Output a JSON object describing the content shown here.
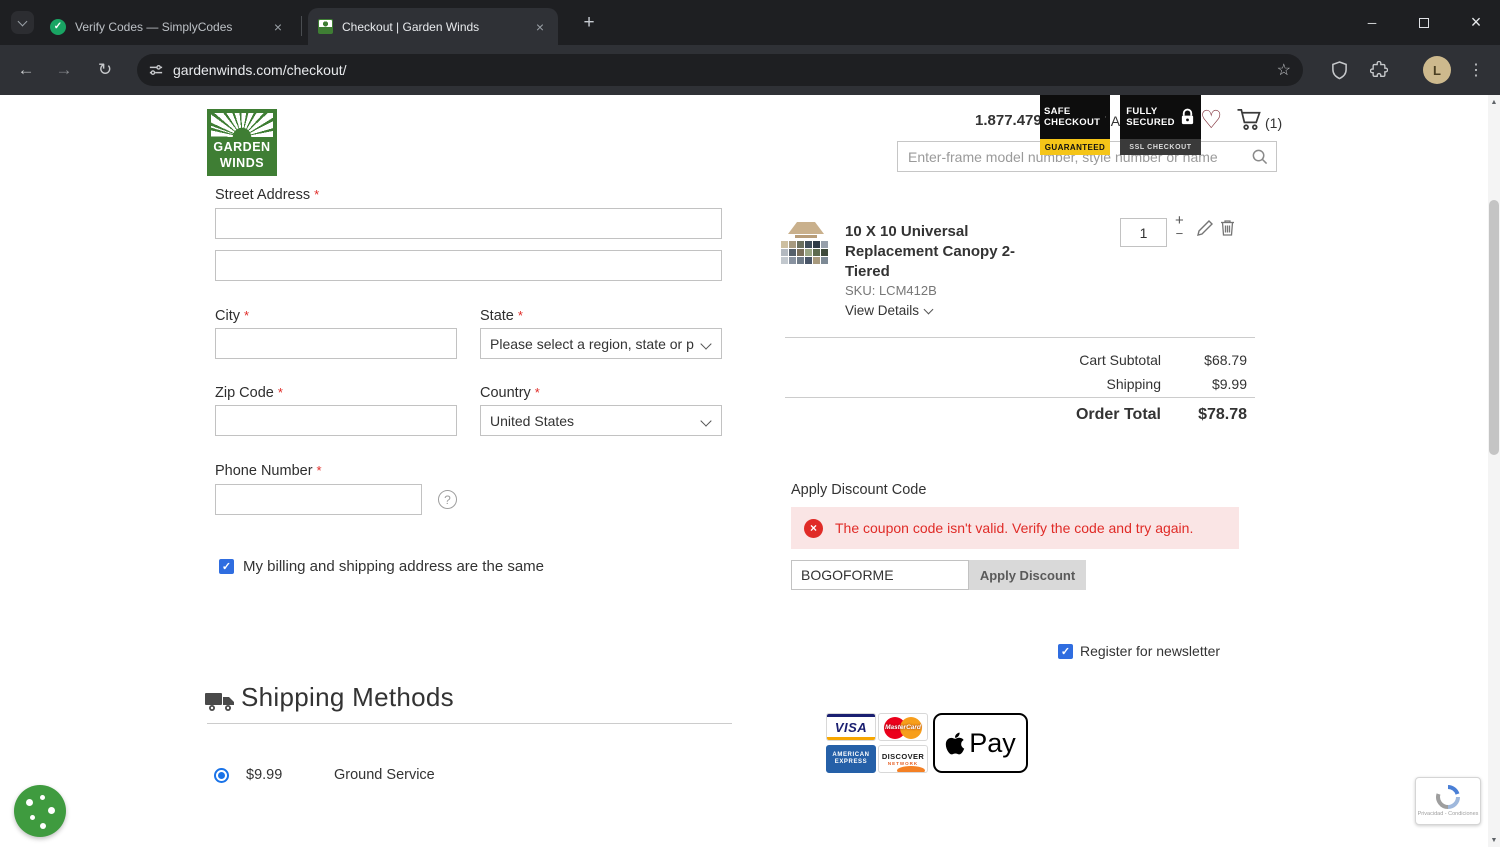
{
  "icons": {
    "close": "×",
    "new_tab": "+",
    "minimize": "─",
    "maximize": "",
    "back": "←",
    "forward": "→",
    "reload": "↻",
    "star": "☆",
    "kebab": "⋮",
    "heart": "♡",
    "caret_down": "▾",
    "help": "?",
    "check": "✓",
    "error_x": "×",
    "plus": "+",
    "minus": "−",
    "up": "▲",
    "down": "▼",
    "fav_check": "✓"
  },
  "browser": {
    "tabs": [
      {
        "title": "Verify Codes — SimplyCodes"
      },
      {
        "title": "Checkout | Garden Winds"
      }
    ],
    "url": "gardenwinds.com/checkout/",
    "avatar": "L"
  },
  "header": {
    "logo_top": "GARDEN",
    "logo_bottom": "WINDS",
    "phone": "1.877.479.4637",
    "account": "My Account",
    "cart_count": "(1)",
    "search_placeholder": "Enter-frame model number, style number or name"
  },
  "form": {
    "required_mark": "*",
    "street_label": "Street Address",
    "city_label": "City",
    "state_label": "State",
    "state_value": "Please select a region, state or p",
    "zip_label": "Zip Code",
    "country_label": "Country",
    "country_value": "United States",
    "phone_label": "Phone Number",
    "billing_checkbox": "My billing and shipping address are the same",
    "shipping_title": "Shipping Methods",
    "shipping_price": "$9.99",
    "shipping_method": "Ground Service"
  },
  "summary": {
    "product_title": "10 X 10 Universal Replacement Canopy 2-Tiered",
    "sku": "SKU: LCM412B",
    "view_details": "View Details",
    "qty": "1",
    "rows": [
      {
        "label": "Cart Subtotal",
        "value": "$68.79"
      },
      {
        "label": "Shipping",
        "value": "$9.99"
      }
    ],
    "total_label": "Order Total",
    "total_value": "$78.78",
    "discount_title": "Apply Discount Code",
    "error_message": "The coupon code isn't valid. Verify the code and try again.",
    "coupon_code": "BOGOFORME",
    "apply_button": "Apply Discount",
    "newsletter": "Register for newsletter"
  },
  "payment": {
    "visa": "VISA",
    "mastercard": "MasterCard",
    "amex_1": "AMERICAN",
    "amex_2": "EXPRESS",
    "discover": "DISCOVER",
    "discover_sub": "NETWORK",
    "applepay": "Pay",
    "safe_1": "SAFE",
    "safe_2": "CHECKOUT",
    "safe_3": "GUARANTEED",
    "secure_1": "FULLY",
    "secure_2": "SECURED",
    "secure_3": "SSL CHECKOUT"
  },
  "colors": {
    "accent_blue": "#2f6de0",
    "error_red": "#e02b27",
    "brand_green": "#3f7e34"
  },
  "recaptcha_text": "Privacidad - Condiciones"
}
